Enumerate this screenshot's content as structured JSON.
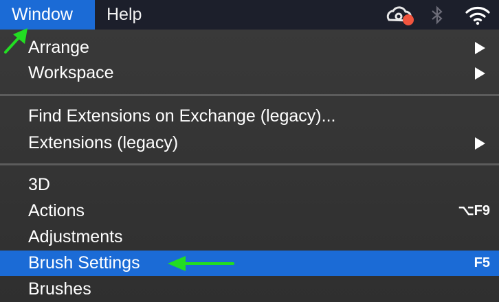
{
  "menubar": {
    "items": [
      {
        "label": "Window",
        "active": true
      },
      {
        "label": "Help",
        "active": false
      }
    ],
    "status_icons": [
      "creative-cloud-icon",
      "bluetooth-icon",
      "wifi-icon"
    ],
    "notification_color": "#f2553e"
  },
  "menu": {
    "items": [
      {
        "label": "Arrange",
        "submenu": true
      },
      {
        "label": "Workspace",
        "submenu": true
      },
      {
        "label": "Find Extensions on Exchange (legacy)...",
        "submenu": false
      },
      {
        "label": "Extensions (legacy)",
        "submenu": true
      },
      {
        "label": "3D",
        "submenu": false
      },
      {
        "label": "Actions",
        "submenu": false,
        "shortcut": "⌥F9"
      },
      {
        "label": "Adjustments",
        "submenu": false
      },
      {
        "label": "Brush Settings",
        "submenu": false,
        "shortcut": "F5",
        "selected": true
      },
      {
        "label": "Brushes",
        "submenu": false
      }
    ]
  },
  "colors": {
    "menubar_bg": "#1c1f2b",
    "highlight": "#1b6bd6",
    "menu_bg": "#353535",
    "annotation_arrow": "#22dd22"
  }
}
